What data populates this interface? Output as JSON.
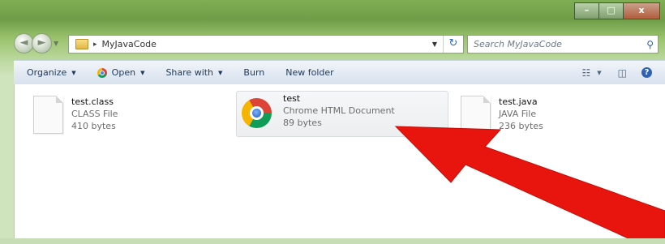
{
  "window": {
    "minimize": "–",
    "maximize": "□",
    "close": "x"
  },
  "nav": {
    "back_icon": "back-arrow-icon",
    "forward_icon": "forward-arrow-icon"
  },
  "address": {
    "path": "MyJavaCode",
    "separator": "▸"
  },
  "search": {
    "placeholder": "Search MyJavaCode"
  },
  "toolbar": {
    "items": [
      {
        "label": "Organize",
        "dropdown": true
      },
      {
        "label": "Open",
        "dropdown": true,
        "icon": "chrome-icon"
      },
      {
        "label": "Share with",
        "dropdown": true
      },
      {
        "label": "Burn",
        "dropdown": false
      },
      {
        "label": "New folder",
        "dropdown": false
      }
    ]
  },
  "files": [
    {
      "name": "test.class",
      "type": "CLASS File",
      "size": "410 bytes"
    },
    {
      "name": "test",
      "type": "Chrome HTML Document",
      "size": "89 bytes",
      "selected": true
    },
    {
      "name": "test.java",
      "type": "JAVA File",
      "size": "236 bytes"
    }
  ],
  "colors": {
    "arrow": "#e8140e",
    "selection": "#eceeef",
    "toolbar_text": "#1e395b"
  }
}
